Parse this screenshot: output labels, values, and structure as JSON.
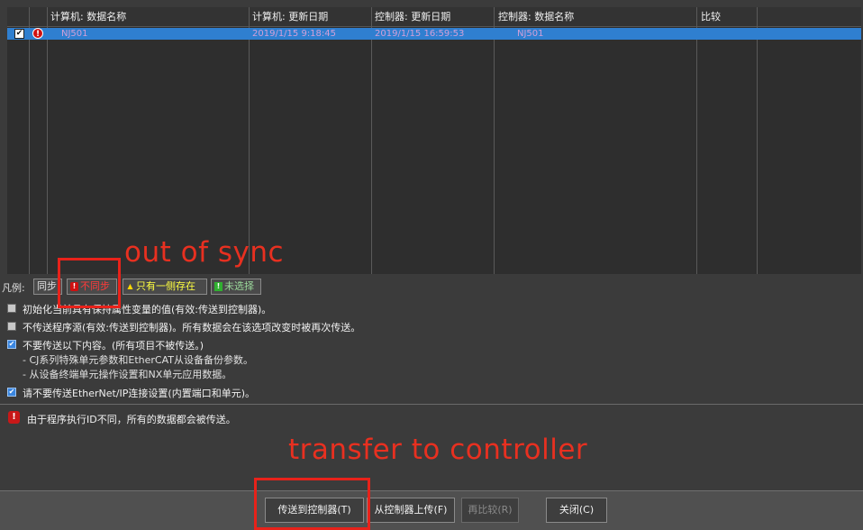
{
  "grid": {
    "columns": [
      "计算机: 数据名称",
      "计算机: 更新日期",
      "控制器: 更新日期",
      "控制器: 数据名称",
      "比较"
    ],
    "rows": [
      {
        "checked": true,
        "status": "out-of-sync",
        "pc_name": "NJ501",
        "pc_date": "2019/1/15 9:18:45",
        "ctrl_date": "2019/1/15 16:59:53",
        "ctrl_name": "NJ501",
        "compare": ""
      }
    ]
  },
  "legend": {
    "label": "凡例:",
    "items": [
      {
        "label": "同步",
        "icon": ""
      },
      {
        "label": "不同步",
        "icon": "error-icon"
      },
      {
        "label": "只有一侧存在",
        "icon": "warning-icon"
      },
      {
        "label": "未选择",
        "icon": "unselected-icon"
      }
    ]
  },
  "options": [
    {
      "checked": false,
      "text": "初始化当前具有保持属性变量的值(有效:传送到控制器)。"
    },
    {
      "checked": false,
      "text": "不传送程序源(有效:传送到控制器)。所有数据会在该选项改变时被再次传送。"
    },
    {
      "checked": true,
      "text": "不要传送以下内容。(所有项目不被传送。)",
      "sub": [
        "- CJ系列特殊单元参数和EtherCAT从设备备份参数。",
        "- 从设备终端单元操作设置和NX单元应用数据。"
      ]
    },
    {
      "checked": true,
      "text": "请不要传送EtherNet/IP连接设置(内置端口和单元)。"
    }
  ],
  "message": "由于程序执行ID不同，所有的数据都会被传送。",
  "buttons": {
    "transfer": "传送到控制器(T)",
    "upload": "从控制器上传(F)",
    "recompare": "再比较(R)",
    "close": "关闭(C)"
  },
  "annotations": {
    "sync": "out of sync",
    "transfer": "transfer to controller"
  },
  "colors": {
    "annotation_red": "#e8221a",
    "row_highlight": "#2f7fd0",
    "panel_bg": "#3b3b3b"
  }
}
